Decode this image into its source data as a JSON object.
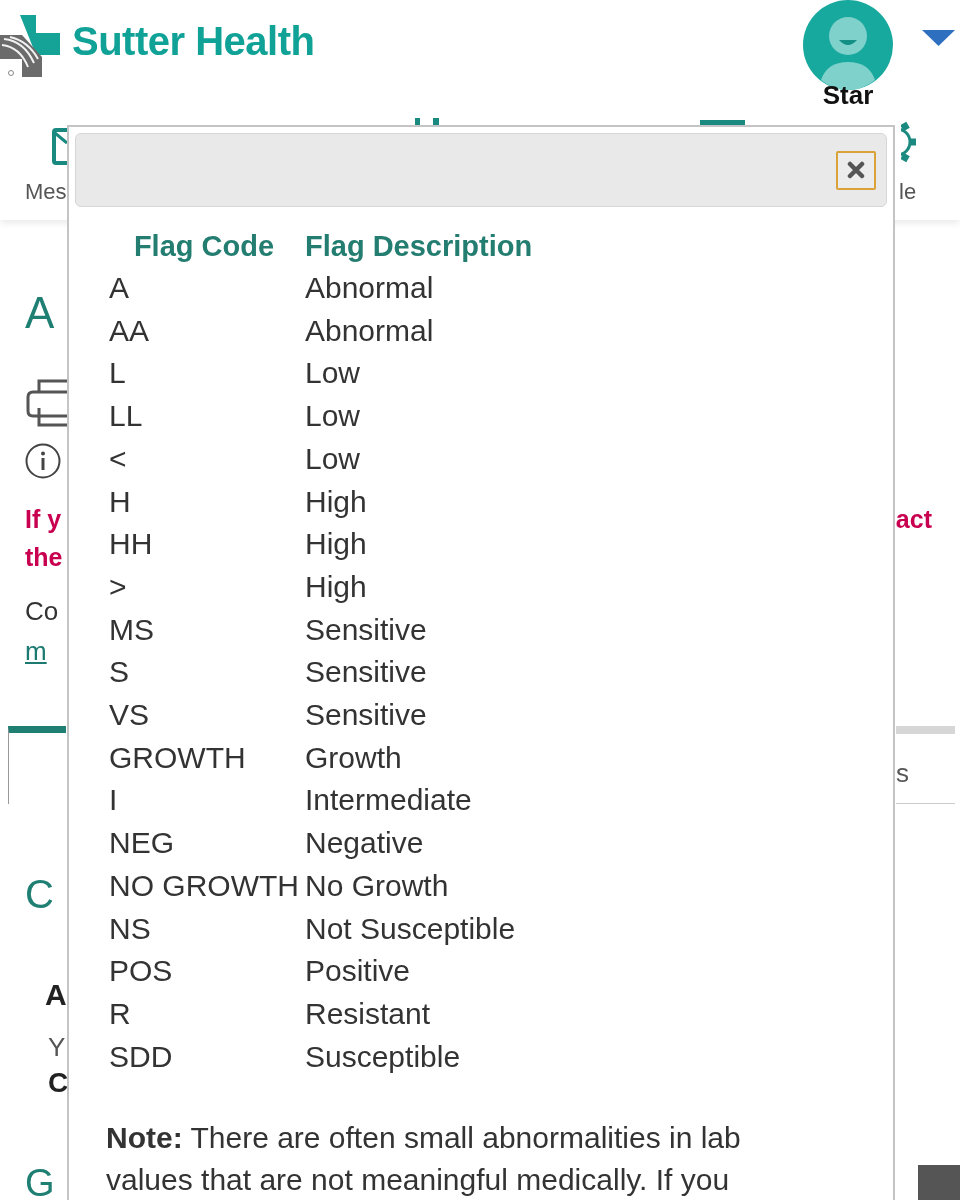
{
  "header": {
    "logo": "Sutter Health",
    "user_name": "Star"
  },
  "nav": [
    {
      "label": "Mes"
    },
    {
      "label": "le"
    }
  ],
  "page": {
    "title": "A",
    "alert": [
      {
        "left": "If y",
        "right": "act"
      },
      {
        "left": "the"
      }
    ],
    "contact": "Co",
    "contact_link": "m",
    "tabs": [
      {
        "selected": true
      },
      {
        "label": "s",
        "selected": false
      }
    ],
    "section_title": "C",
    "card": {
      "title": "A",
      "line_1": "Y",
      "line_2": "C"
    },
    "next_section_title": "G"
  },
  "dialog": {
    "table": {
      "columns": [
        "Flag Code",
        "Flag Description"
      ],
      "rows": [
        [
          "A",
          "Abnormal"
        ],
        [
          "AA",
          "Abnormal"
        ],
        [
          "L",
          "Low"
        ],
        [
          "LL",
          "Low"
        ],
        [
          "<",
          "Low"
        ],
        [
          "H",
          "High"
        ],
        [
          "HH",
          "High"
        ],
        [
          ">",
          "High"
        ],
        [
          "MS",
          "Sensitive"
        ],
        [
          "S",
          "Sensitive"
        ],
        [
          "VS",
          "Sensitive"
        ],
        [
          "GROWTH",
          "Growth"
        ],
        [
          "I",
          "Intermediate"
        ],
        [
          "NEG",
          "Negative"
        ],
        [
          "NO GROWTH",
          "No Growth"
        ],
        [
          "NS",
          "Not Susceptible"
        ],
        [
          "POS",
          "Positive"
        ],
        [
          "R",
          "Resistant"
        ],
        [
          "SDD",
          "Susceptible"
        ]
      ]
    },
    "note": "**Note:** There are often small abnormalities in lab values that are not meaningful medically. If you"
  }
}
